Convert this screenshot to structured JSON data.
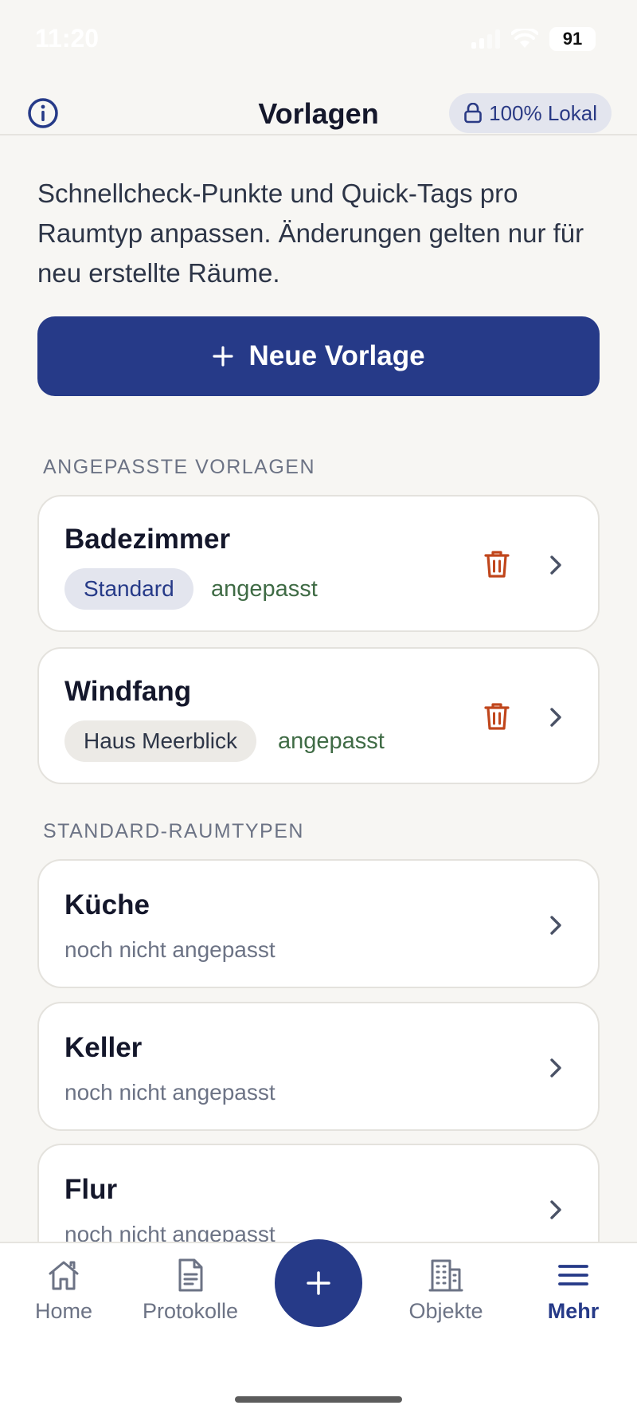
{
  "status_bar": {
    "time": "11:20",
    "battery": "91"
  },
  "header": {
    "title": "Vorlagen",
    "badge_label": "100% Lokal",
    "info_icon": "info-icon",
    "lock_icon": "lock-icon"
  },
  "intro": {
    "text": "Schnellcheck-Punkte und Quick-Tags pro Raumtyp anpassen. Änderungen gelten nur für neu erstellte Räume."
  },
  "new_template_button": {
    "icon": "plus-icon",
    "label": "Neue Vorlage"
  },
  "custom_section": {
    "label": "ANGEPASSTE VORLAGEN",
    "items": [
      {
        "title": "Badezimmer",
        "tag": "Standard",
        "status": "angepasst"
      },
      {
        "title": "Windfang",
        "tag": "Haus Meerblick",
        "status": "angepasst"
      }
    ]
  },
  "standard_section": {
    "label": "STANDARD-RAUMTYPEN",
    "items": [
      {
        "title": "Küche",
        "status": "noch nicht angepasst"
      },
      {
        "title": "Keller",
        "status": "noch nicht angepasst"
      },
      {
        "title": "Flur",
        "status": "noch nicht angepasst"
      }
    ]
  },
  "bottom_nav": {
    "items": [
      {
        "label": "Home",
        "icon": "home-icon"
      },
      {
        "label": "Protokolle",
        "icon": "document-icon"
      },
      {
        "label": "Objekte",
        "icon": "building-icon"
      },
      {
        "label": "Mehr",
        "icon": "menu-icon"
      }
    ],
    "fab_icon": "plus-icon",
    "active": "Mehr"
  },
  "colors": {
    "primary": "#263a88",
    "background": "#f7f6f3",
    "danger": "#c0461c",
    "success_text": "#3f6b45"
  }
}
